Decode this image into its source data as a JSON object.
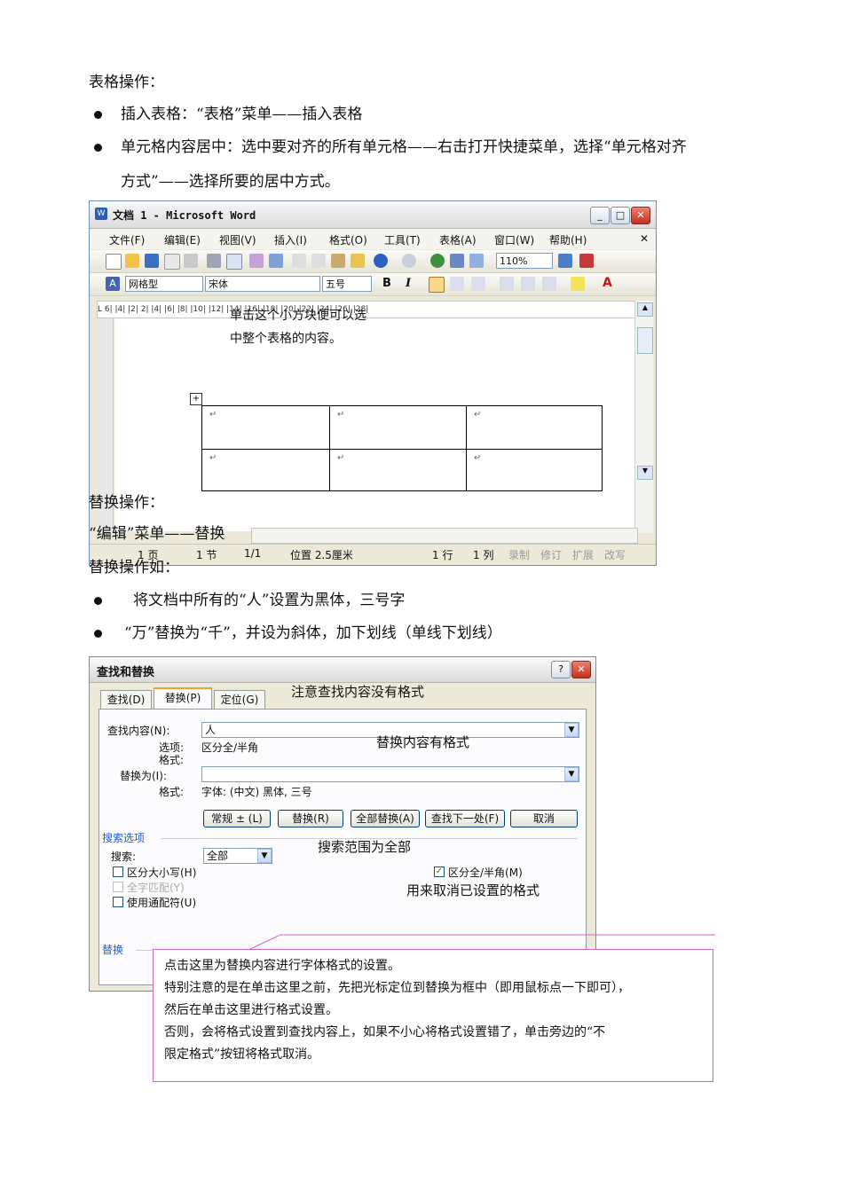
{
  "heading1": "表格操作：",
  "bullet1": "插入表格：“表格”菜单——插入表格",
  "bullet2_line1": "单元格内容居中：选中要对齐的所有单元格——右击打开快捷菜单，选择“单元格对齐",
  "bullet2_line2": "方式”——选择所要的居中方式。",
  "word": {
    "title": "文档 1 - Microsoft Word",
    "menus": [
      "文件(F)",
      "编辑(E)",
      "视图(V)",
      "插入(I)",
      "格式(O)",
      "工具(T)",
      "表格(A)",
      "窗口(W)",
      "帮助(H)"
    ],
    "zoom": "110%",
    "style": "网格型",
    "font": "宋体",
    "size": "五号",
    "bold": "B",
    "italic": "I",
    "ruler_text": "L  6|  |4|  |2|       2|  |4|  |6|  |8|  |10|  |12|  |14|  |16|  |18|  |20|  |22|  |24|  |26|  |28|",
    "annotation_line1": "单击这个小方块便可以选",
    "annotation_line2": "中整个表格的内容。",
    "cell_mark": "↵",
    "status": {
      "page": "1 页",
      "section": "1 节",
      "pages": "1/1",
      "position": "位置 2.5厘米",
      "line": "1 行",
      "col": "1 列",
      "rec": "录制",
      "trk": "修订",
      "ext": "扩展",
      "ovr": "改写"
    }
  },
  "overlap1": "替换操作：",
  "overlap2": "“编辑”菜单——替换",
  "overlap3": "替换操作如：",
  "bullet3": "将文档中所有的“人”设置为黑体，三号字",
  "bullet4": "“万”替换为“千”，并设为斜体，加下划线（单线下划线）",
  "dialog": {
    "title": "查找和替换",
    "tabs": [
      "查找(D)",
      "替换(P)",
      "定位(G)"
    ],
    "find_label": "查找内容(N):",
    "find_value": "人",
    "options_label": "选项:",
    "options_value": "区分全/半角",
    "format_label": "格式:",
    "replace_label": "替换为(I):",
    "replace_value": "",
    "replace_format_label": "格式:",
    "replace_format_value": "字体: (中文) 黑体, 三号",
    "buttons": [
      "常规 ± (L)",
      "替换(R)",
      "全部替换(A)",
      "查找下一处(F)",
      "取消"
    ],
    "search_options": "搜索选项",
    "search_label": "搜索:",
    "search_value": "全部",
    "match_case": "区分大小写(H)",
    "whole_word": "全字匹配(Y)",
    "wildcards": "使用通配符(U)",
    "width_match": "区分全/半角(M)",
    "replace_section": "替换"
  },
  "notes": {
    "find_no_format": "注意查找内容没有格式",
    "replace_has_format": "替换内容有格式",
    "search_all": "搜索范围为全部",
    "cancel_format": "用来取消已设置的格式"
  },
  "callout": [
    "点击这里为替换内容进行字体格式的设置。",
    "特别注意的是在单击这里之前，先把光标定位到替换为框中（即用鼠标点一下即可），",
    "然后在单击这里进行格式设置。",
    "否则，会将格式设置到查找内容上，如果不小心将格式设置错了，单击旁边的“不",
    "限定格式”按钮将格式取消。"
  ],
  "colors": {
    "callout_border": "#d466c8",
    "accent": "#316ac5",
    "close": "#d9534f"
  }
}
